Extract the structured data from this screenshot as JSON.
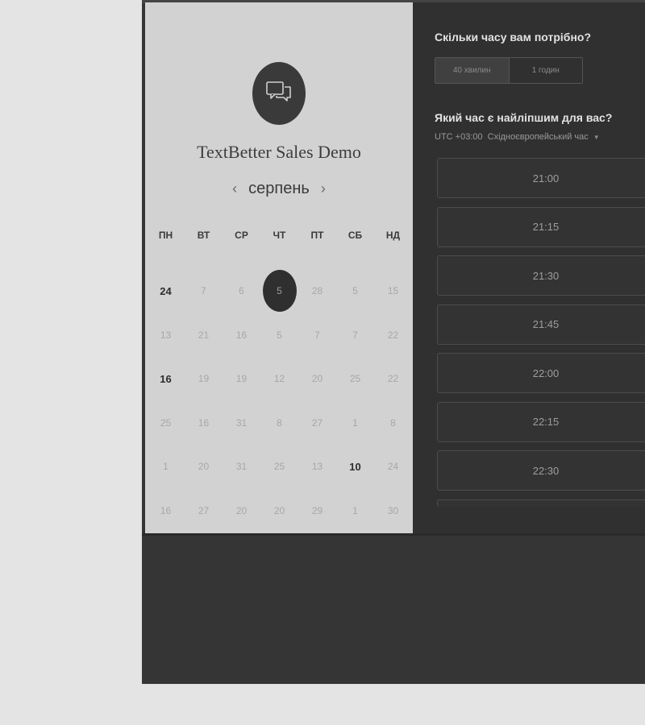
{
  "booking": {
    "company_name": "TextBetter Sales Demo",
    "logo_icon": "chat-bubbles-icon"
  },
  "calendar": {
    "month": "серпень",
    "prev_icon": "chevron-left-icon",
    "next_icon": "chevron-right-icon",
    "weekdays": [
      "ПН",
      "ВТ",
      "СР",
      "ЧТ",
      "ПТ",
      "СБ",
      "НД"
    ],
    "weeks": [
      [
        "24",
        "7",
        "6",
        "5",
        "28",
        "5",
        "15"
      ],
      [
        "13",
        "21",
        "16",
        "5",
        "7",
        "7",
        "22"
      ],
      [
        "16",
        "19",
        "19",
        "12",
        "20",
        "25",
        "22"
      ],
      [
        "25",
        "16",
        "31",
        "8",
        "27",
        "1",
        "8"
      ],
      [
        "1",
        "20",
        "31",
        "25",
        "13",
        "10",
        "24"
      ],
      [
        "16",
        "27",
        "20",
        "20",
        "29",
        "1",
        "30"
      ]
    ],
    "selected_day": "5"
  },
  "duration": {
    "question": "Скільки часу вам потрібно?",
    "options": [
      "40 хвилин",
      "1 годин"
    ],
    "selected": "40 хвилин"
  },
  "time": {
    "question": "Який час є найліпшим для вас?",
    "timezone_utc": "UTC +03:00",
    "timezone_name": "Східноєвропейський час",
    "dropdown_icon": "caret-down-icon",
    "slots": [
      "21:00",
      "21:15",
      "21:30",
      "21:45",
      "22:00",
      "22:15",
      "22:30"
    ]
  },
  "colors": {
    "page_bg": "#e4e4e4",
    "left_panel_bg": "#d2d2d2",
    "right_panel_bg": "#303030",
    "selected_day_bg": "#2f2f2f"
  }
}
